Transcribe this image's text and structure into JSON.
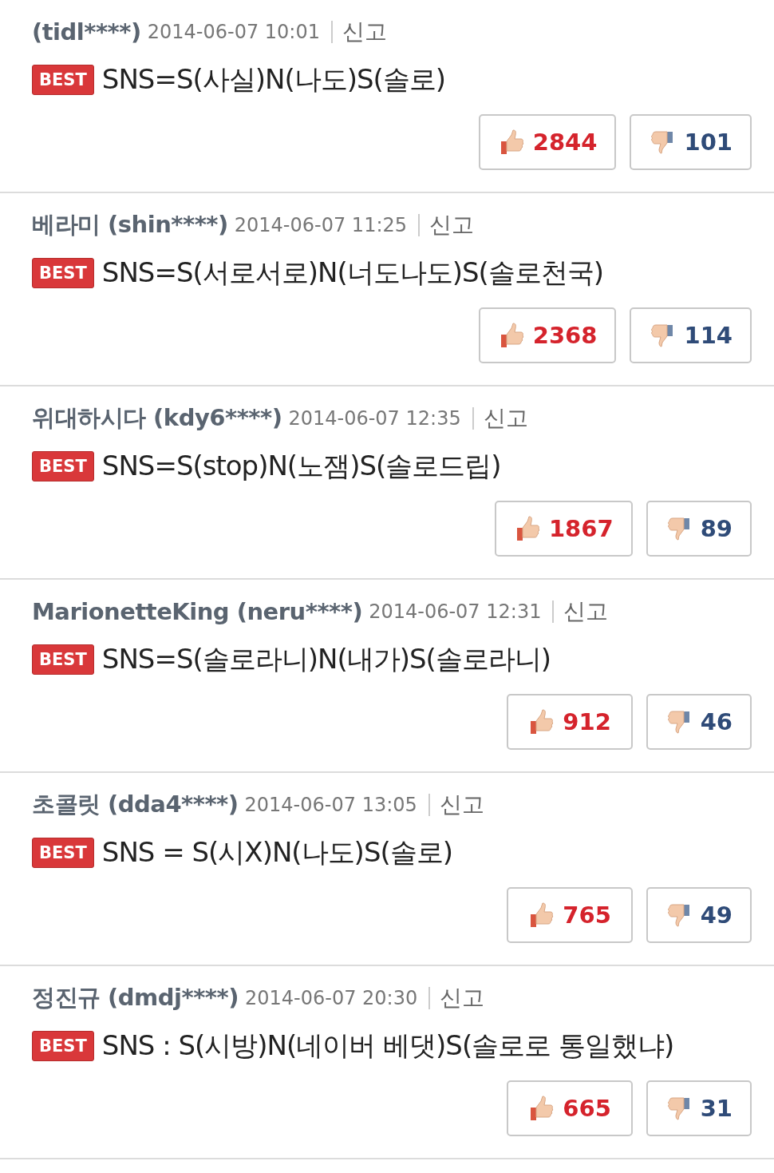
{
  "comments": [
    {
      "author": "(tidl****)",
      "date": "2014-06-07 10:01",
      "report": "신고",
      "badge": "BEST",
      "text": "SNS=S(사실)N(나도)S(솔로)",
      "likes": "2844",
      "dislikes": "101"
    },
    {
      "author": "베라미 (shin****)",
      "date": "2014-06-07 11:25",
      "report": "신고",
      "badge": "BEST",
      "text": "SNS=S(서로서로)N(너도나도)S(솔로천국)",
      "likes": "2368",
      "dislikes": "114"
    },
    {
      "author": "위대하시다 (kdy6****)",
      "date": "2014-06-07 12:35",
      "report": "신고",
      "badge": "BEST",
      "text": "SNS=S(stop)N(노잼)S(솔로드립)",
      "likes": "1867",
      "dislikes": "89"
    },
    {
      "author": "MarionetteKing (neru****)",
      "date": "2014-06-07 12:31",
      "report": "신고",
      "badge": "BEST",
      "text": "SNS=S(솔로라니)N(내가)S(솔로라니)",
      "likes": "912",
      "dislikes": "46"
    },
    {
      "author": "초콜릿 (dda4****)",
      "date": "2014-06-07 13:05",
      "report": "신고",
      "badge": "BEST",
      "text": "SNS = S(시X)N(나도)S(솔로)",
      "likes": "765",
      "dislikes": "49"
    },
    {
      "author": "정진규 (dmdj****)",
      "date": "2014-06-07 20:30",
      "report": "신고",
      "badge": "BEST",
      "text": "SNS : S(시방)N(네이버 베댓)S(솔로로 통일했냐)",
      "likes": "665",
      "dislikes": "31"
    }
  ]
}
